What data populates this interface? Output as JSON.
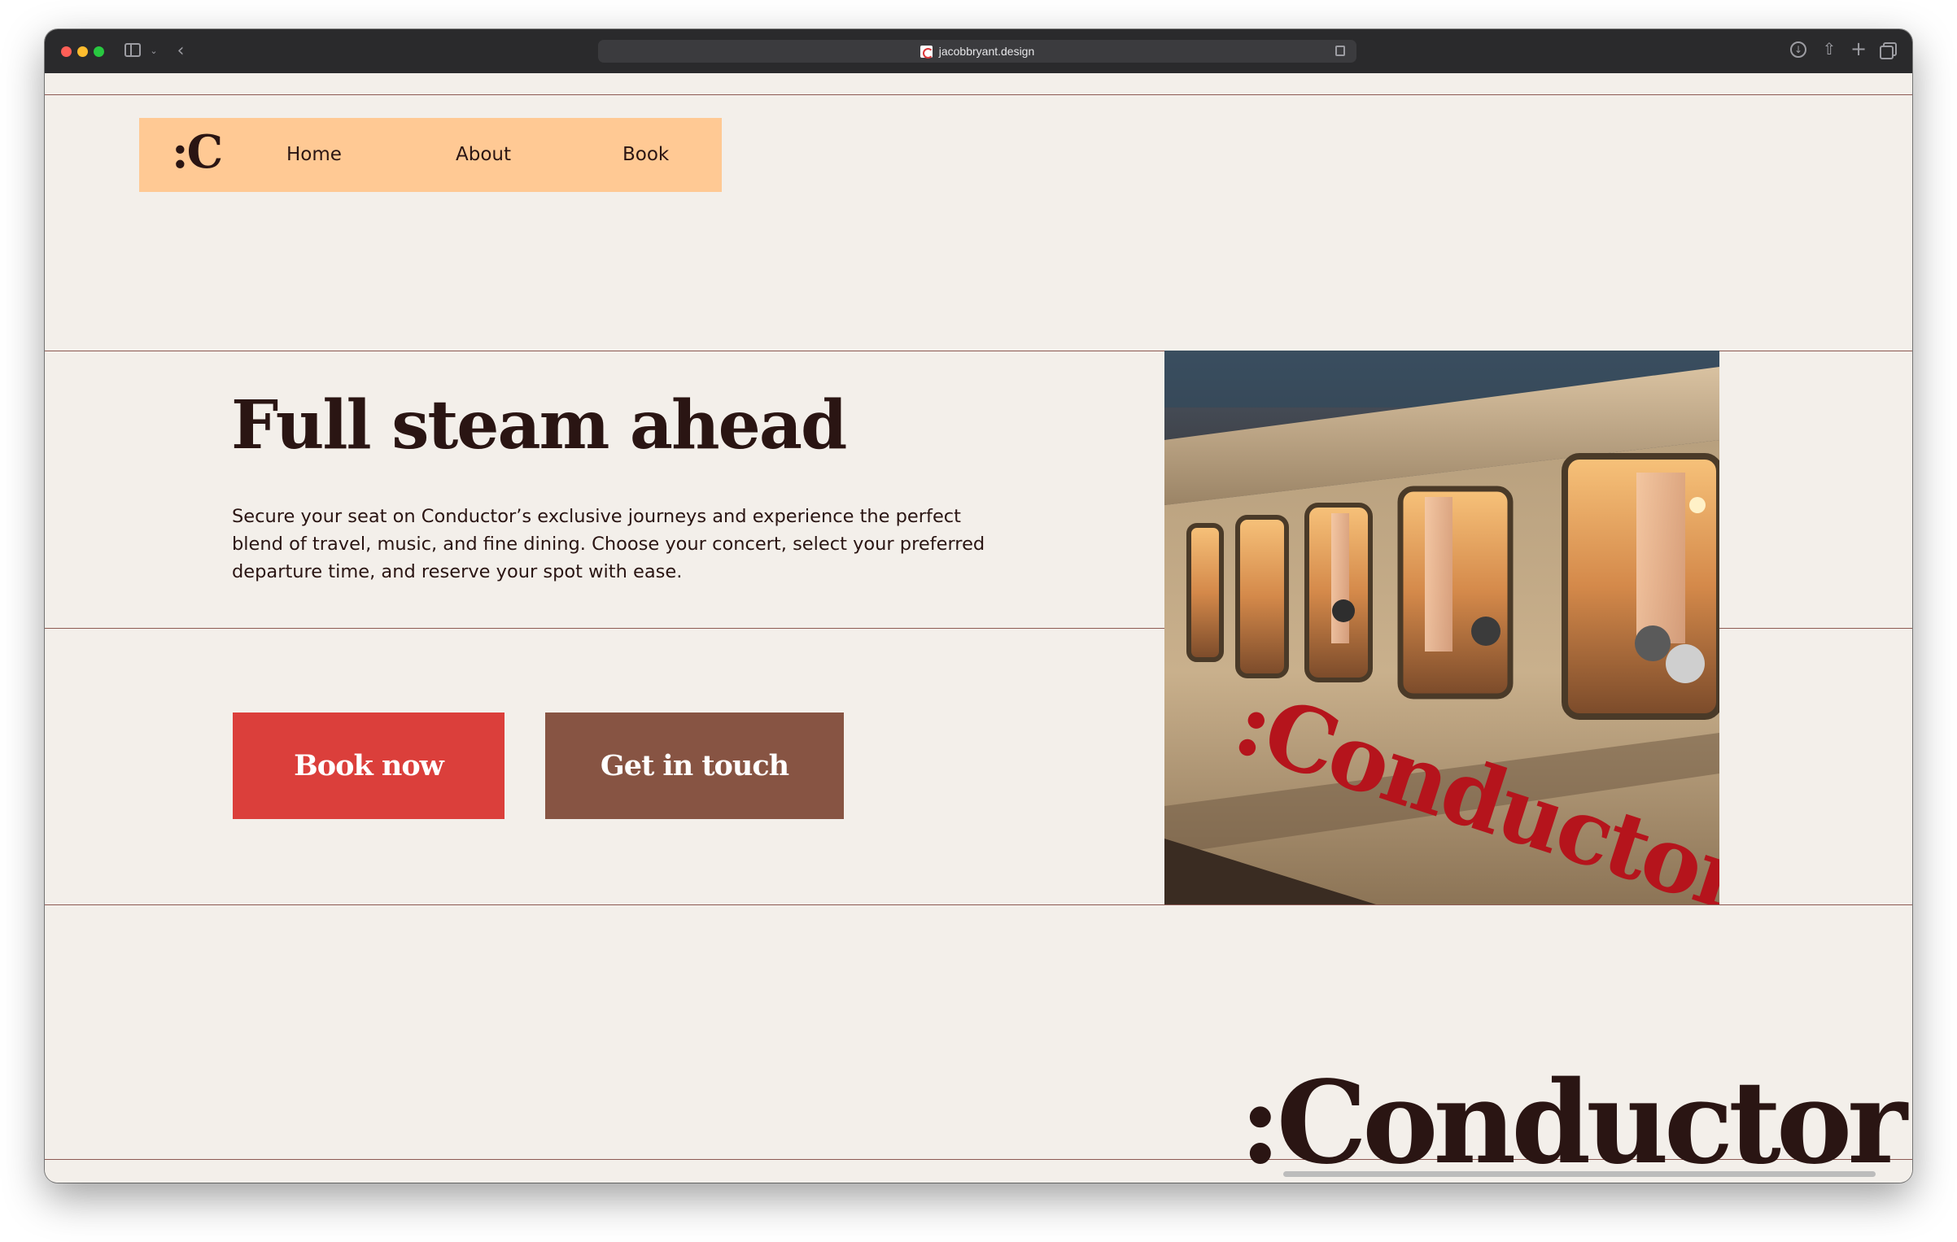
{
  "browser": {
    "url": "jacobbryant.design"
  },
  "nav": {
    "logo": ":C",
    "links": [
      "Home",
      "About",
      "Book"
    ]
  },
  "hero": {
    "title": "Full steam ahead",
    "description": "Secure your seat on Conductor’s exclusive journeys and experience the perfect blend of travel, music, and fine dining. Choose your concert, select your preferred departure time, and reserve your spot with ease.",
    "primary_button": "Book now",
    "secondary_button": "Get in touch"
  },
  "image": {
    "train_lettering": ":Conductor"
  },
  "footer": {
    "brand": ":Conductor"
  },
  "colors": {
    "background": "#f3efea",
    "nav_bg": "#ffc994",
    "primary": "#db3f3b",
    "secondary": "#875443",
    "text": "#2a1513",
    "rule": "#8d5a53"
  },
  "icons": [
    "sidebar-icon",
    "chevron-down-icon",
    "back-icon",
    "favicon-icon",
    "reader-icon",
    "download-icon",
    "share-icon",
    "plus-icon",
    "tabs-icon"
  ]
}
